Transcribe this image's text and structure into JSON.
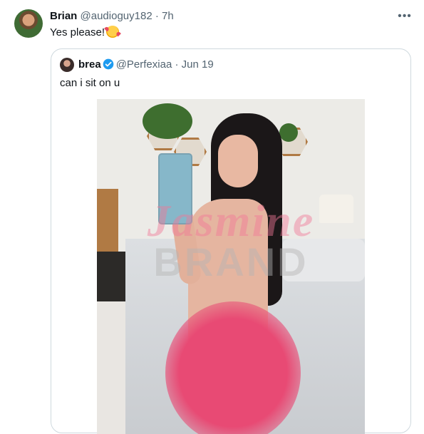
{
  "tweet": {
    "author_name": "Brian",
    "handle": "@audioguy182",
    "separator": "·",
    "time": "7h",
    "text": "Yes please!",
    "emoji": "smiling-face-with-hearts",
    "more_icon": "more-horizontal-icon"
  },
  "quoted_tweet": {
    "author_name": "brea",
    "verified": true,
    "handle": "@Perfexiaa",
    "separator": "·",
    "date": "Jun 19",
    "text": "can i sit on u",
    "media": {
      "watermark_line1": "Jasmine",
      "watermark_line2": "BRAND",
      "censor_color": "#e84a74"
    }
  },
  "colors": {
    "text_primary": "#0f1419",
    "text_secondary": "#536471",
    "border": "#cfd9de",
    "verified_blue": "#1d9bf0"
  }
}
